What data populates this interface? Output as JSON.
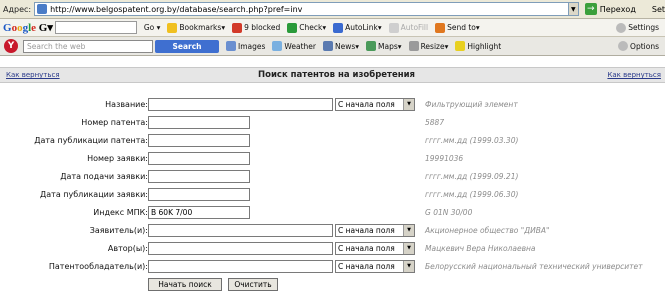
{
  "browser": {
    "address_label": "Адрес:",
    "url": "http://www.belgospatent.org.by/database/search.php?pref=inv",
    "go_label": "Переход",
    "settings_label": "Set"
  },
  "google_toolbar": {
    "logo": "Google",
    "search_go": "Go",
    "bookmarks": "Bookmarks",
    "blocked": "9 blocked",
    "check": "Check",
    "autolink": "AutoLink",
    "autofill": "AutoFill",
    "send_to": "Send to",
    "options": "Settings"
  },
  "yahoo_toolbar": {
    "search_placeholder": "Search the web",
    "search_button": "Search",
    "images": "Images",
    "weather": "Weather",
    "news": "News",
    "maps": "Maps",
    "resize": "Resize",
    "highlight": "Highlight",
    "options": "Options"
  },
  "page": {
    "back_link_left": "Как вернуться",
    "back_link_right": "Как вернуться",
    "title": "Поиск патентов на изобретения"
  },
  "form": {
    "fields": [
      {
        "label": "Название:",
        "value": "",
        "select": "С начала поля",
        "hint": "Фильтрующий элемент"
      },
      {
        "label": "Номер патента:",
        "value": "",
        "hint": "5887"
      },
      {
        "label": "Дата публикации патента:",
        "value": "",
        "hint": "гггг.мм.дд (1999.03.30)"
      },
      {
        "label": "Номер заявки:",
        "value": "",
        "hint": "19991036"
      },
      {
        "label": "Дата подачи заявки:",
        "value": "",
        "hint": "гггг.мм.дд (1999.09.21)"
      },
      {
        "label": "Дата публикации заявки:",
        "value": "",
        "hint": "гггг.мм.дд (1999.06.30)"
      },
      {
        "label": "Индекс МПК:",
        "value": "B 60K 7/00",
        "hint": "G 01N 30/00"
      },
      {
        "label": "Заявитель(и):",
        "value": "",
        "select": "С начала поля",
        "hint": "Акционерное общество \"ДИВА\""
      },
      {
        "label": "Автор(ы):",
        "value": "",
        "select": "С начала поля",
        "hint": "Мацкевич Вера Николаевна"
      },
      {
        "label": "Патентообладатель(и):",
        "value": "",
        "select": "С начала поля",
        "hint": "Белорусский национальный технический университет"
      }
    ],
    "submit": "Начать поиск",
    "clear": "Очистить"
  }
}
